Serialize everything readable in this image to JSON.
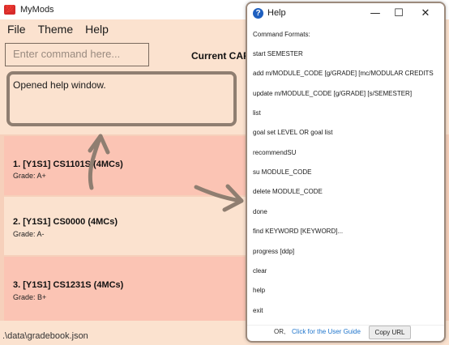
{
  "app": {
    "title": "MyMods",
    "icon_glyph": "💯",
    "icon_color": "#d62a2a"
  },
  "menu": [
    "File",
    "Theme",
    "Help"
  ],
  "command_box": {
    "placeholder": "Enter command here..."
  },
  "cap_label": "Current CAP",
  "result_message": "Opened help window.",
  "modules": [
    {
      "title": "1.  [Y1S1]  CS1101S (4MCs)",
      "grade": "Grade: A+",
      "color": "#fbc4b4"
    },
    {
      "title": "2.  [Y1S1] CS0000 (4MCs)",
      "grade": "Grade: A-",
      "color": "#fbe2cf"
    },
    {
      "title": "3.  [Y1S1] CS1231S (4MCs)",
      "grade": "Grade: B+",
      "color": "#fbc4b4"
    }
  ],
  "status_path": ".\\data\\gradebook.json",
  "help": {
    "title": "Help",
    "window_buttons": {
      "minimize": "—",
      "maximize": "☐",
      "close": "✕"
    },
    "lines": [
      "Command Formats:",
      "start SEMESTER",
      "add m/MODULE_CODE [g/GRADE] [mc/MODULAR CREDITS",
      "update m/MODULE_CODE [g/GRADE] [s/SEMESTER]",
      "list",
      "goal set LEVEL OR goal list",
      "recommendSU",
      "su MODULE_CODE",
      "delete MODULE_CODE",
      "done",
      "find KEYWORD [KEYWORD]...",
      "progress [ddp]",
      "clear",
      "help",
      "exit"
    ],
    "footer": {
      "or_label": "OR,",
      "link_label": "Click for the User Guide",
      "copy_button": "Copy URL"
    }
  },
  "colors": {
    "background": "#fbe2cf",
    "card_pink": "#fbc4b4",
    "card_peach": "#fbe2cf",
    "border_brown": "#8f7e71",
    "link_blue": "#1f75cc"
  }
}
